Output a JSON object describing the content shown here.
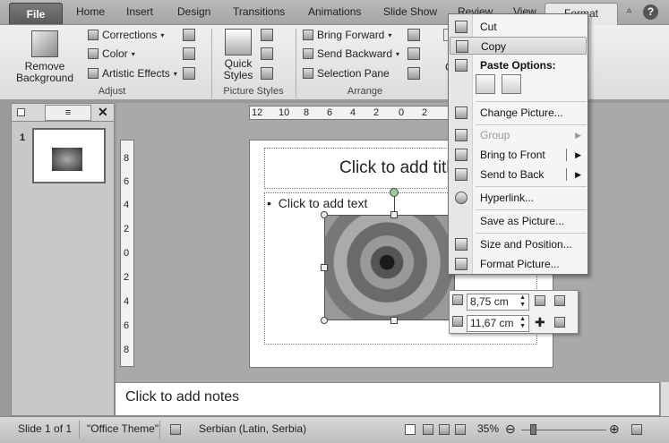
{
  "ribbon_tabs": {
    "file": "File",
    "home": "Home",
    "insert": "Insert",
    "design": "Design",
    "transitions": "Transitions",
    "animations": "Animations",
    "slide_show": "Slide Show",
    "review": "Review",
    "view": "View",
    "format": "Format"
  },
  "ribbon": {
    "remove_background": [
      "Remove",
      "Background"
    ],
    "corrections": "Corrections",
    "color": "Color",
    "artistic_effects": "Artistic Effects",
    "adjust_label": "Adjust",
    "quick_styles": [
      "Quick",
      "Styles"
    ],
    "picture_styles_label": "Picture Styles",
    "bring_forward": "Bring Forward",
    "send_backward": "Send Backward",
    "selection_pane": "Selection Pane",
    "arrange_label": "Arrange",
    "partial_c": "C"
  },
  "slides_pane": {
    "slide_number": "1"
  },
  "rulers": {
    "horizontal": [
      "12",
      "10",
      "8",
      "6",
      "4",
      "2",
      "0",
      "2"
    ],
    "vertical": [
      "8",
      "6",
      "4",
      "2",
      "0",
      "2",
      "4",
      "6",
      "8"
    ]
  },
  "slide": {
    "title_placeholder": "Click to add title",
    "body_placeholder": "Click to add text",
    "bullet": "•"
  },
  "context_menu": {
    "cut": "Cut",
    "copy": "Copy",
    "paste_options": "Paste Options:",
    "change_picture": "Change Picture...",
    "group": "Group",
    "bring_to_front": "Bring to Front",
    "send_to_back": "Send to Back",
    "hyperlink": "Hyperlink...",
    "save_as_picture": "Save as Picture...",
    "size_and_position": "Size and Position...",
    "format_picture": "Format Picture..."
  },
  "mini_toolbar": {
    "height": "8,75 cm",
    "width": "11,67 cm"
  },
  "notes": {
    "placeholder": "Click to add notes"
  },
  "status_bar": {
    "slide_info": "Slide 1 of 1",
    "theme": "\"Office Theme\"",
    "language": "Serbian (Latin, Serbia)",
    "zoom": "35%"
  }
}
